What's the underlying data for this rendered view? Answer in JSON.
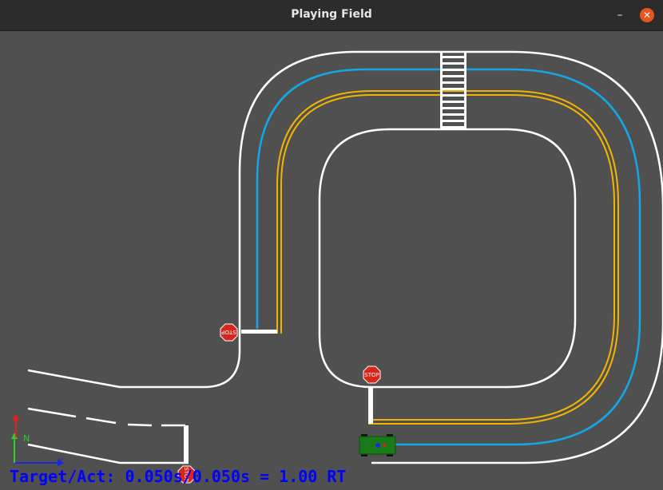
{
  "window": {
    "title": "Playing Field",
    "minimize_label": "–",
    "close_label": "✕"
  },
  "colors": {
    "ground": "#505050",
    "road_edge": "#ffffff",
    "center_line": "#f0b400",
    "path": "#14a8e6",
    "stop_sign": "#d9261c",
    "vehicle": "#1a7a1a",
    "status_text": "#0000ff"
  },
  "signs": {
    "stop_text": "STOP"
  },
  "axes": {
    "x_label": "X",
    "y_label": "Y",
    "n_label": "N"
  },
  "status": {
    "text": "Target/Act: 0.050s/0.050s = 1.00 RT"
  }
}
